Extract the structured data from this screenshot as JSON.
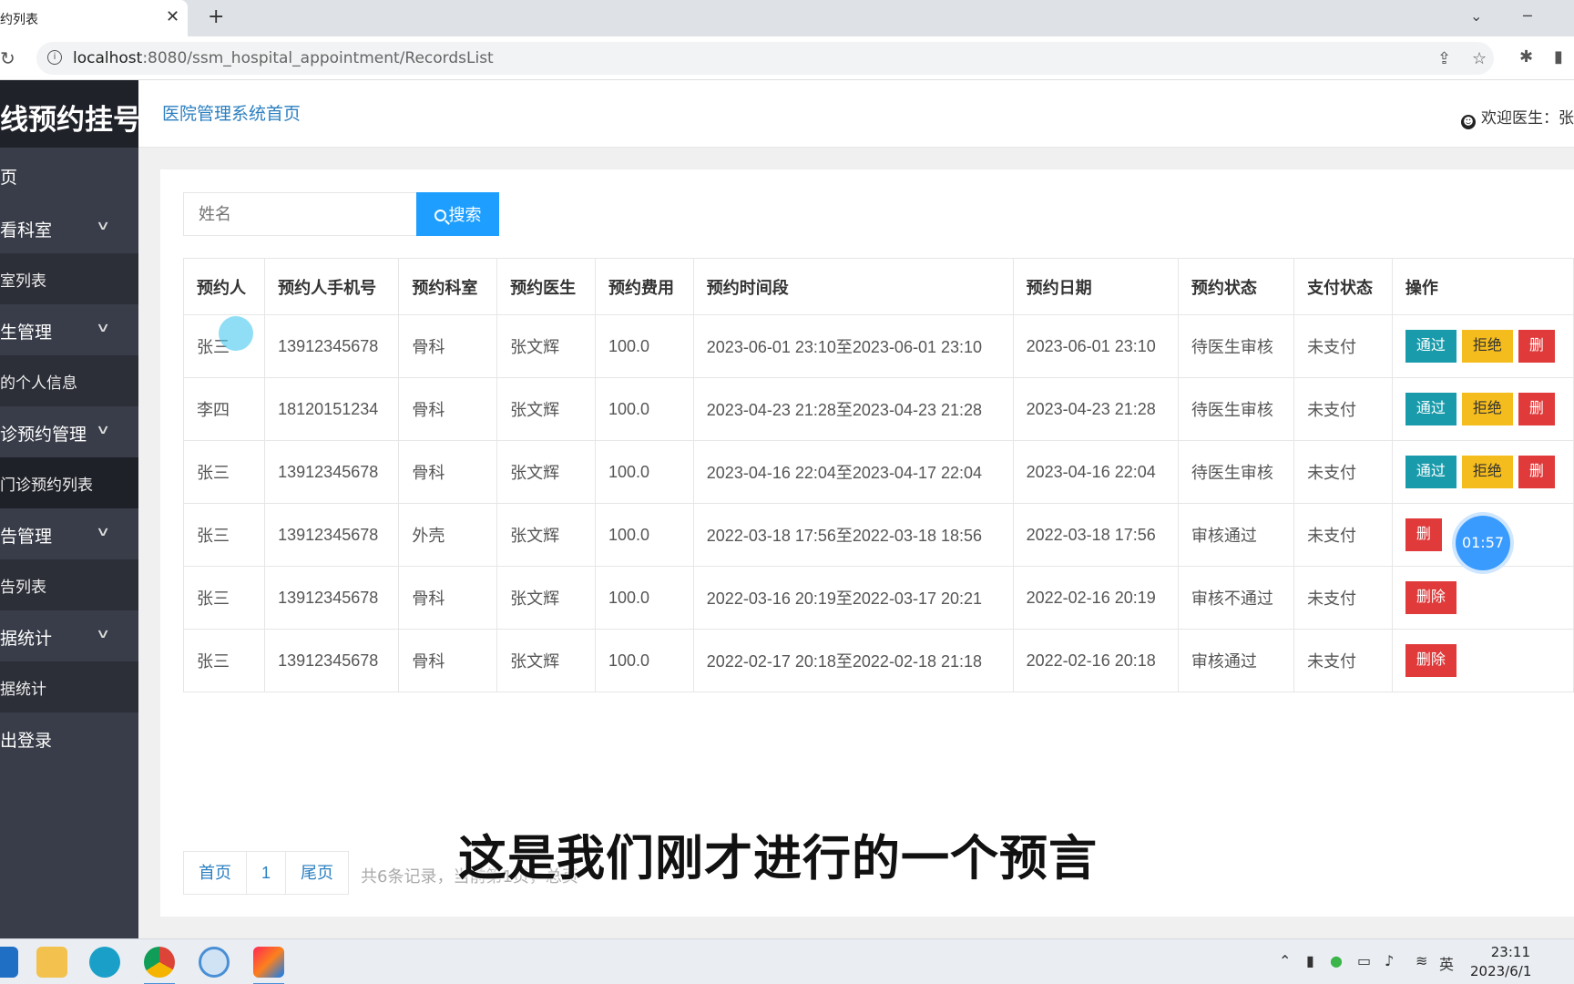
{
  "browser": {
    "tab_title": "约列表",
    "tab_close": "✕",
    "new_tab": "+",
    "url_host": "localhost",
    "url_path": ":8080/ssm_hospital_appointment/RecordsList"
  },
  "sidebar": {
    "brand": "线预约挂号",
    "items": [
      {
        "label": "页",
        "has_chevron": false
      },
      {
        "label": "看科室",
        "has_chevron": true
      },
      {
        "label": "室列表",
        "has_chevron": false
      },
      {
        "label": "生管理",
        "has_chevron": true
      },
      {
        "label": "的个人信息",
        "has_chevron": false
      },
      {
        "label": "诊预约管理",
        "has_chevron": true
      },
      {
        "label": "门诊预约列表",
        "has_chevron": false
      },
      {
        "label": "告管理",
        "has_chevron": true
      },
      {
        "label": "告列表",
        "has_chevron": false
      },
      {
        "label": "据统计",
        "has_chevron": true
      },
      {
        "label": "据统计",
        "has_chevron": false
      },
      {
        "label": "出登录",
        "has_chevron": false
      }
    ]
  },
  "header": {
    "home_link": "医院管理系统首页",
    "welcome": "欢迎医生：张"
  },
  "search": {
    "placeholder": "姓名",
    "button_label": "搜索"
  },
  "table": {
    "columns": [
      "预约人",
      "预约人手机号",
      "预约科室",
      "预约医生",
      "预约费用",
      "预约时间段",
      "预约日期",
      "预约状态",
      "支付状态",
      "操作"
    ],
    "rows": [
      {
        "name": "张三",
        "phone": "13912345678",
        "dept": "骨科",
        "doctor": "张文辉",
        "fee": "100.0",
        "period": "2023-06-01 23:10至2023-06-01 23:10",
        "date": "2023-06-01 23:10",
        "status": "待医生审核",
        "pay": "未支付",
        "actions": [
          "通过",
          "拒绝",
          "删"
        ]
      },
      {
        "name": "李四",
        "phone": "18120151234",
        "dept": "骨科",
        "doctor": "张文辉",
        "fee": "100.0",
        "period": "2023-04-23 21:28至2023-04-23 21:28",
        "date": "2023-04-23 21:28",
        "status": "待医生审核",
        "pay": "未支付",
        "actions": [
          "通过",
          "拒绝",
          "删"
        ]
      },
      {
        "name": "张三",
        "phone": "13912345678",
        "dept": "骨科",
        "doctor": "张文辉",
        "fee": "100.0",
        "period": "2023-04-16 22:04至2023-04-17 22:04",
        "date": "2023-04-16 22:04",
        "status": "待医生审核",
        "pay": "未支付",
        "actions": [
          "通过",
          "拒绝",
          "删"
        ]
      },
      {
        "name": "张三",
        "phone": "13912345678",
        "dept": "外壳",
        "doctor": "张文辉",
        "fee": "100.0",
        "period": "2022-03-18 17:56至2022-03-18 18:56",
        "date": "2022-03-18 17:56",
        "status": "审核通过",
        "pay": "未支付",
        "actions": [
          "删"
        ]
      },
      {
        "name": "张三",
        "phone": "13912345678",
        "dept": "骨科",
        "doctor": "张文辉",
        "fee": "100.0",
        "period": "2022-03-16 20:19至2022-03-17 20:21",
        "date": "2022-02-16 20:19",
        "status": "审核不通过",
        "pay": "未支付",
        "actions": [
          "删除"
        ]
      },
      {
        "name": "张三",
        "phone": "13912345678",
        "dept": "骨科",
        "doctor": "张文辉",
        "fee": "100.0",
        "period": "2022-02-17 20:18至2022-02-18 21:18",
        "date": "2022-02-16 20:18",
        "status": "审核通过",
        "pay": "未支付",
        "actions": [
          "删除"
        ]
      }
    ]
  },
  "pager": {
    "first": "首页",
    "current": "1",
    "last": "尾页",
    "info": "共6条记录，当前第1页，总页"
  },
  "overlay": {
    "subtitle": "这是我们刚才进行的一个预言",
    "timer": "01:57"
  },
  "taskbar": {
    "ime": "英",
    "time": "23:11",
    "date": "2023/6/1"
  },
  "colors": {
    "sidebar_bg": "#393d49",
    "brand_bg": "#20222a",
    "search_btn": "#1e9fff",
    "btn_pass": "#1a9bab",
    "btn_reject": "#f4bc1c",
    "btn_delete": "#e03a3a"
  }
}
